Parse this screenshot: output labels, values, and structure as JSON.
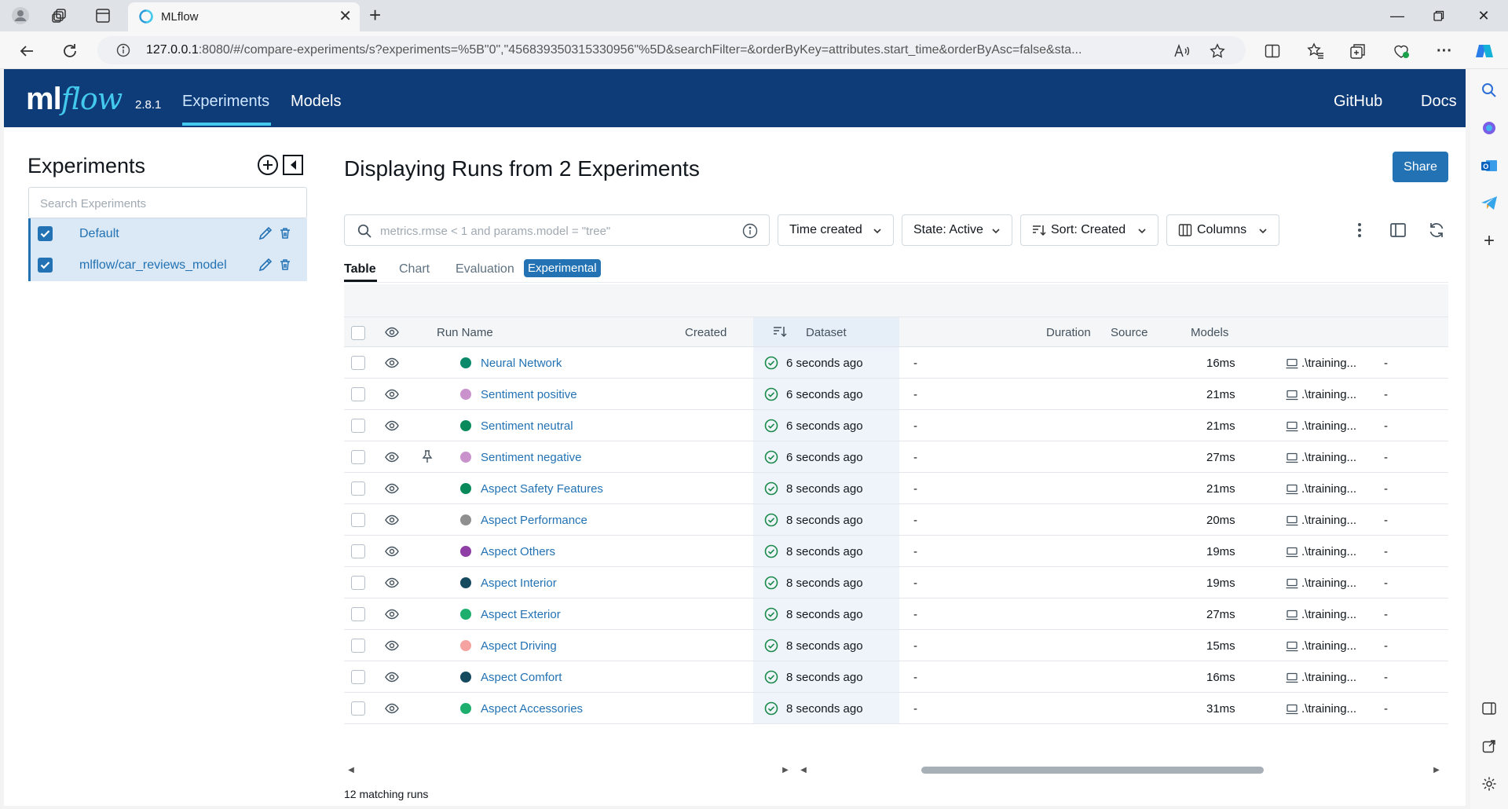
{
  "browser": {
    "tab_title": "MLflow",
    "url_host": "127.0.0.1",
    "url_rest": ":8080/#/compare-experiments/s?experiments=%5B\"0\",\"456839350315330956\"%5D&searchFilter=&orderByKey=attributes.start_time&orderByAsc=false&sta..."
  },
  "header": {
    "logo_ml": "ml",
    "logo_flow": "flow",
    "version": "2.8.1",
    "nav_experiments": "Experiments",
    "nav_models": "Models",
    "nav_github": "GitHub",
    "nav_docs": "Docs"
  },
  "sidebar": {
    "title": "Experiments",
    "search_placeholder": "Search Experiments",
    "experiments": [
      {
        "name": "Default"
      },
      {
        "name": "mlflow/car_reviews_model"
      }
    ]
  },
  "main": {
    "title": "Displaying Runs from 2 Experiments",
    "share_label": "Share",
    "filter_placeholder": "metrics.rmse < 1 and params.model = \"tree\"",
    "time_created_label": "Time created",
    "state_label": "State: Active",
    "sort_label": "Sort: Created",
    "columns_label": "Columns",
    "tabs": {
      "table": "Table",
      "chart": "Chart",
      "evaluation": "Evaluation",
      "experimental": "Experimental"
    },
    "columns": {
      "run_name": "Run Name",
      "created": "Created",
      "dataset": "Dataset",
      "duration": "Duration",
      "source": "Source",
      "models": "Models"
    },
    "runs": [
      {
        "name": "Neural Network",
        "color": "#0a8a6a",
        "created": "6 seconds ago",
        "dataset": "-",
        "duration": "16ms",
        "source": ".\\training...",
        "models": "-"
      },
      {
        "name": "Sentiment positive",
        "color": "#c992cc",
        "created": "6 seconds ago",
        "dataset": "-",
        "duration": "21ms",
        "source": ".\\training...",
        "models": "-"
      },
      {
        "name": "Sentiment neutral",
        "color": "#0a8a5a",
        "created": "6 seconds ago",
        "dataset": "-",
        "duration": "21ms",
        "source": ".\\training...",
        "models": "-"
      },
      {
        "name": "Sentiment negative",
        "color": "#c992cc",
        "created": "6 seconds ago",
        "dataset": "-",
        "duration": "27ms",
        "source": ".\\training...",
        "models": "-"
      },
      {
        "name": "Aspect Safety Features",
        "color": "#0a8a5a",
        "created": "8 seconds ago",
        "dataset": "-",
        "duration": "21ms",
        "source": ".\\training...",
        "models": "-"
      },
      {
        "name": "Aspect Performance",
        "color": "#8f8f8f",
        "created": "8 seconds ago",
        "dataset": "-",
        "duration": "20ms",
        "source": ".\\training...",
        "models": "-"
      },
      {
        "name": "Aspect Others",
        "color": "#8e3ea4",
        "created": "8 seconds ago",
        "dataset": "-",
        "duration": "19ms",
        "source": ".\\training...",
        "models": "-"
      },
      {
        "name": "Aspect Interior",
        "color": "#164a5e",
        "created": "8 seconds ago",
        "dataset": "-",
        "duration": "19ms",
        "source": ".\\training...",
        "models": "-"
      },
      {
        "name": "Aspect Exterior",
        "color": "#1eae6e",
        "created": "8 seconds ago",
        "dataset": "-",
        "duration": "27ms",
        "source": ".\\training...",
        "models": "-"
      },
      {
        "name": "Aspect Driving",
        "color": "#f5a3a0",
        "created": "8 seconds ago",
        "dataset": "-",
        "duration": "15ms",
        "source": ".\\training...",
        "models": "-"
      },
      {
        "name": "Aspect Comfort",
        "color": "#164a5e",
        "created": "8 seconds ago",
        "dataset": "-",
        "duration": "16ms",
        "source": ".\\training...",
        "models": "-"
      },
      {
        "name": "Aspect Accessories",
        "color": "#1eae6e",
        "created": "8 seconds ago",
        "dataset": "-",
        "duration": "31ms",
        "source": ".\\training...",
        "models": "-"
      }
    ],
    "matching_runs": "12 matching runs"
  }
}
